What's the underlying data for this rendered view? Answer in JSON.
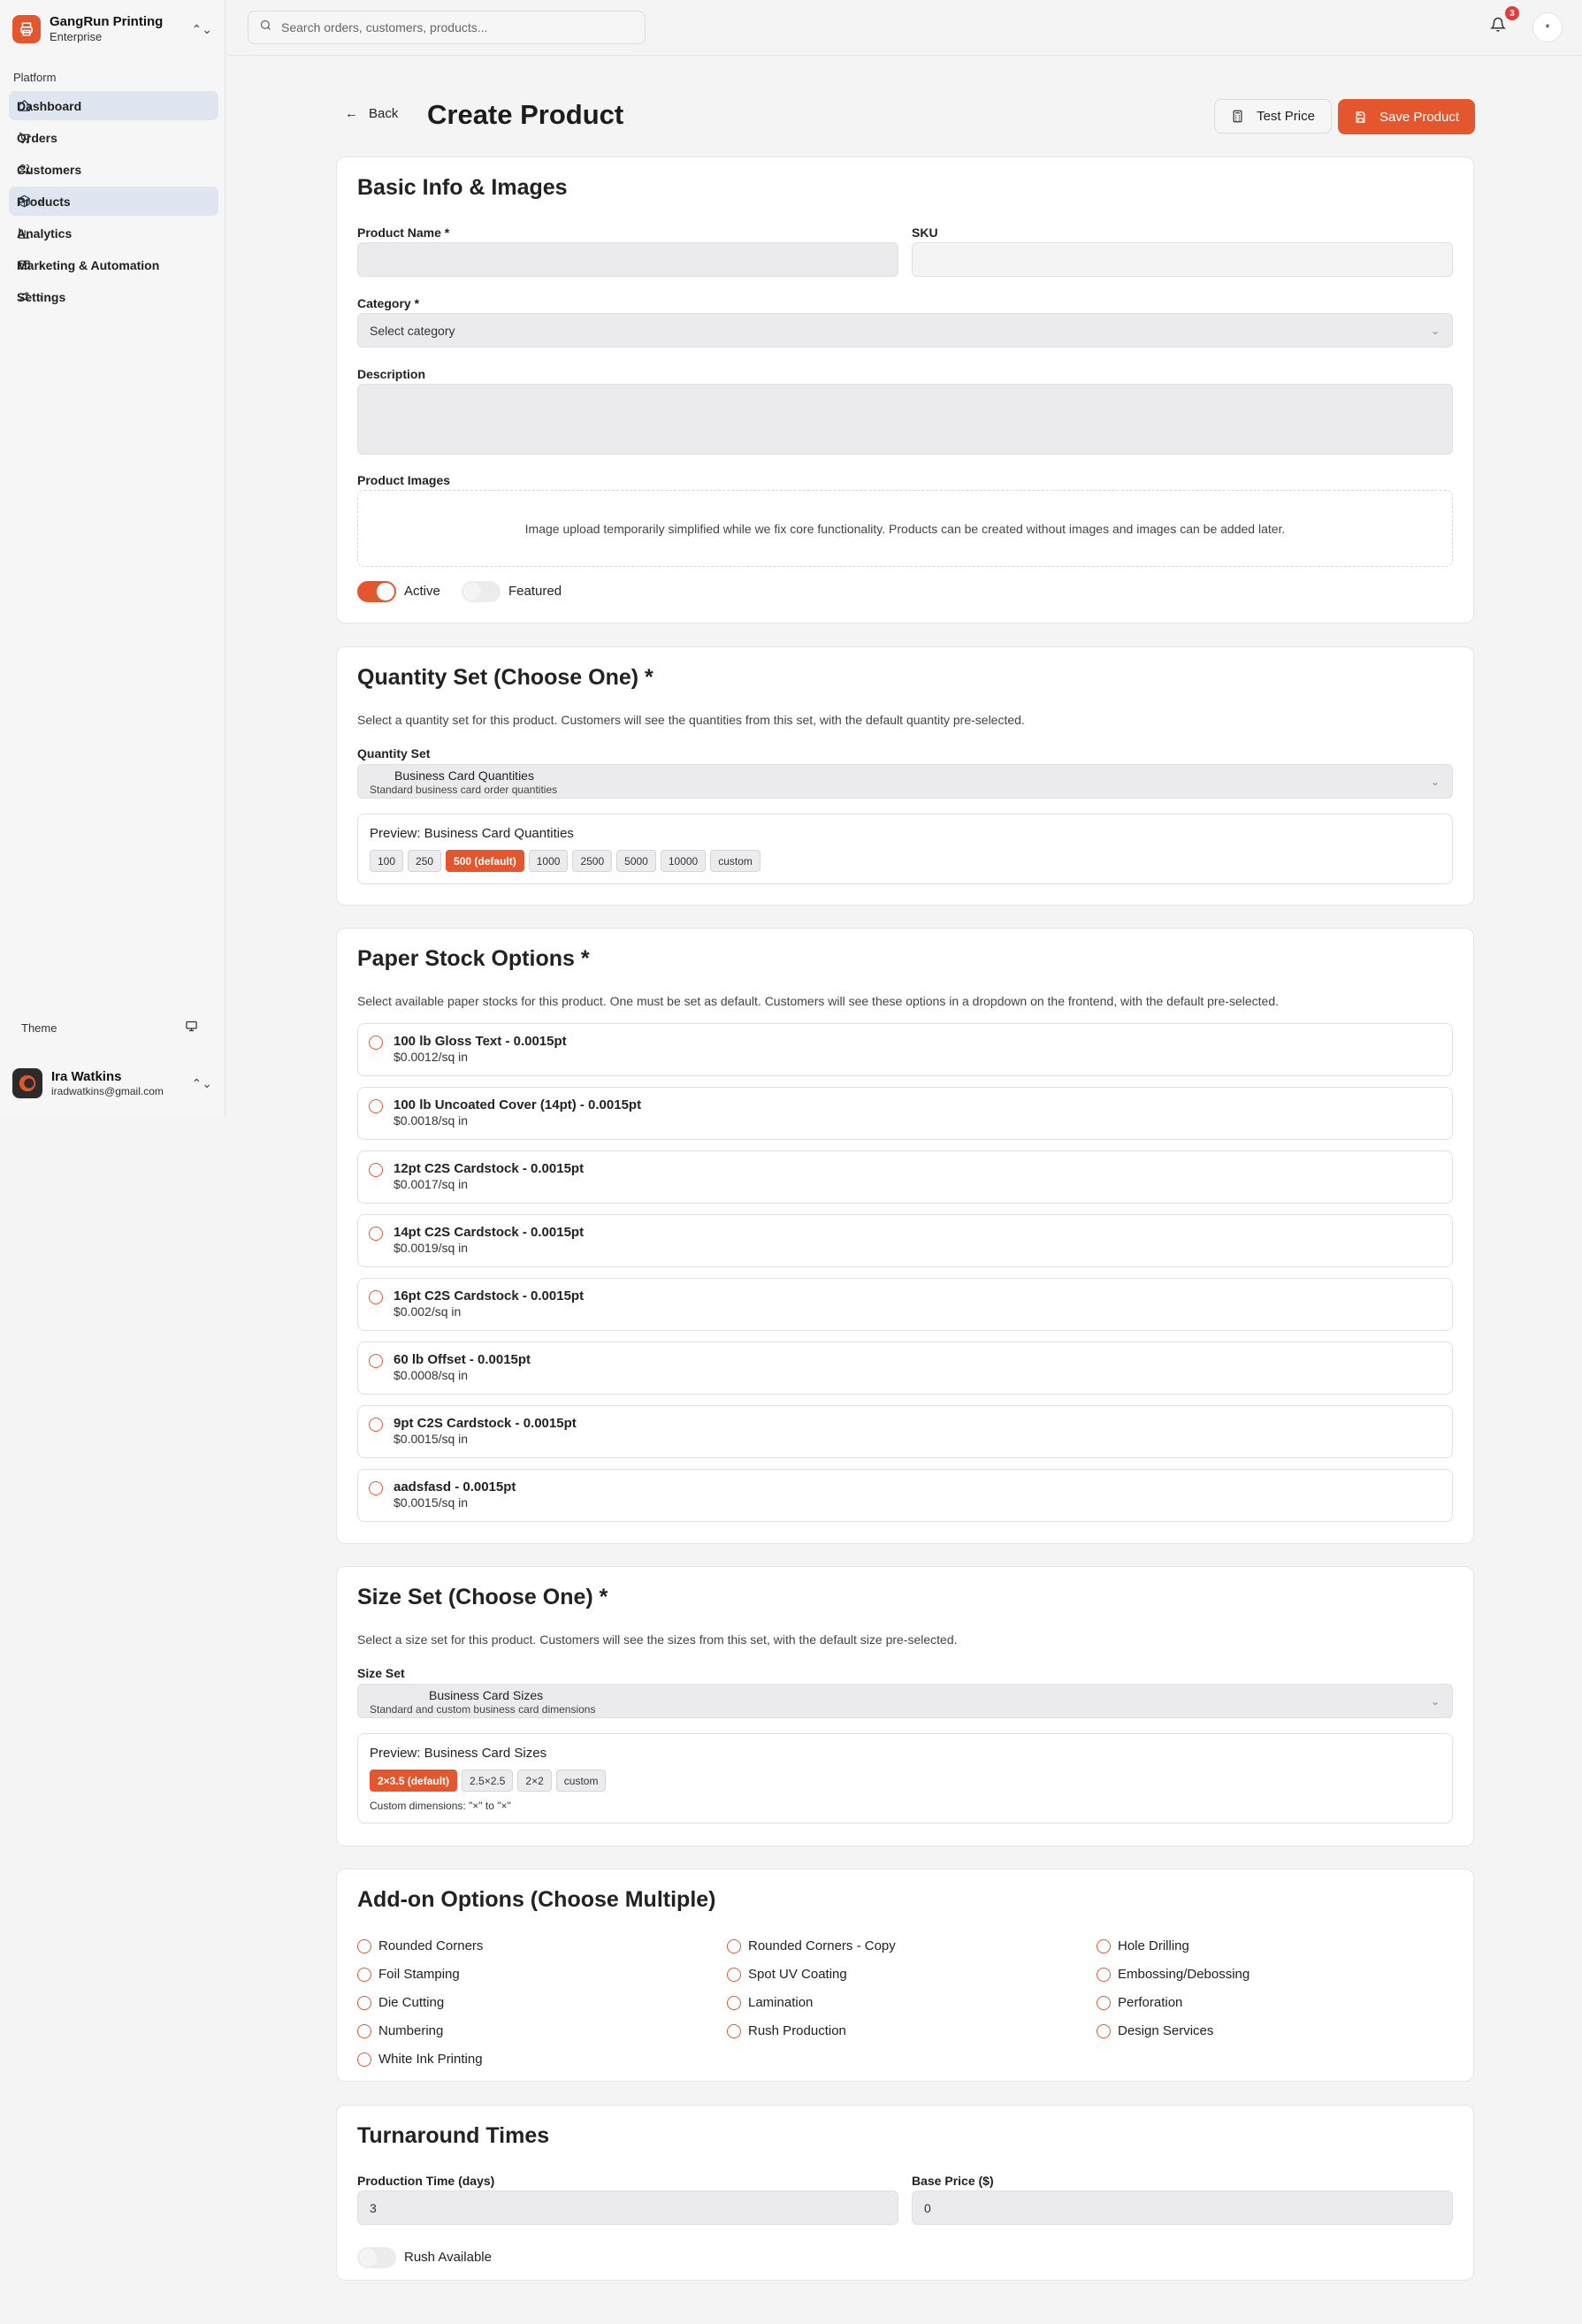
{
  "brand": {
    "name": "GangRun Printing",
    "plan": "Enterprise"
  },
  "sidebar": {
    "section_label": "Platform",
    "items": [
      {
        "label": "Dashboard"
      },
      {
        "label": "Orders"
      },
      {
        "label": "Customers"
      },
      {
        "label": "Products"
      },
      {
        "label": "Analytics"
      },
      {
        "label": "Marketing & Automation"
      },
      {
        "label": "Settings"
      }
    ],
    "theme_label": "Theme",
    "user": {
      "name": "Ira Watkins",
      "email": "iradwatkins@gmail.com"
    }
  },
  "topbar": {
    "search_placeholder": "Search orders, customers, products...",
    "notification_count": "3",
    "avatar_initial": "*"
  },
  "header": {
    "back_label": "Back",
    "title": "Create Product",
    "test_price_label": "Test Price",
    "save_label": "Save Product"
  },
  "basic_info": {
    "title": "Basic Info & Images",
    "product_name_label": "Product Name *",
    "sku_label": "SKU",
    "category_label": "Category *",
    "category_placeholder": "Select category",
    "description_label": "Description",
    "images_label": "Product Images",
    "images_note": "Image upload temporarily simplified while we fix core functionality. Products can be created without images and images can be added later.",
    "active_label": "Active",
    "featured_label": "Featured"
  },
  "quantity_set": {
    "title": "Quantity Set (Choose One) *",
    "help": "Select a quantity set for this product. Customers will see the quantities from this set, with the default quantity pre-selected.",
    "field_label": "Quantity Set",
    "selected_name": "Business Card Quantities",
    "selected_desc": "Standard business card order quantities",
    "preview_title": "Preview: Business Card Quantities",
    "chips": [
      "100",
      "250",
      "500 (default)",
      "1000",
      "2500",
      "5000",
      "10000",
      "custom"
    ]
  },
  "paper_stock": {
    "title": "Paper Stock Options *",
    "help": "Select available paper stocks for this product. One must be set as default. Customers will see these options in a dropdown on the frontend, with the default pre-selected.",
    "options": [
      {
        "name": "100 lb Gloss Text - 0.0015pt",
        "price": "$0.0012/sq in"
      },
      {
        "name": "100 lb Uncoated Cover (14pt) - 0.0015pt",
        "price": "$0.0018/sq in"
      },
      {
        "name": "12pt C2S Cardstock - 0.0015pt",
        "price": "$0.0017/sq in"
      },
      {
        "name": "14pt C2S Cardstock - 0.0015pt",
        "price": "$0.0019/sq in"
      },
      {
        "name": "16pt C2S Cardstock - 0.0015pt",
        "price": "$0.002/sq in"
      },
      {
        "name": "60 lb Offset - 0.0015pt",
        "price": "$0.0008/sq in"
      },
      {
        "name": "9pt C2S Cardstock - 0.0015pt",
        "price": "$0.0015/sq in"
      },
      {
        "name": "aadsfasd - 0.0015pt",
        "price": "$0.0015/sq in"
      }
    ]
  },
  "size_set": {
    "title": "Size Set (Choose One) *",
    "help": "Select a size set for this product. Customers will see the sizes from this set, with the default size pre-selected.",
    "field_label": "Size Set",
    "selected_name": "Business Card Sizes",
    "selected_desc": "Standard and custom business card dimensions",
    "preview_title": "Preview: Business Card Sizes",
    "chips": [
      "2×3.5 (default)",
      "2.5×2.5",
      "2×2",
      "custom"
    ],
    "custom_dimensions": "Custom dimensions: \"×\" to \"×\""
  },
  "addons": {
    "title": "Add-on Options (Choose Multiple)",
    "items": [
      "Rounded Corners",
      "Rounded Corners - Copy",
      "Hole Drilling",
      "Foil Stamping",
      "Spot UV Coating",
      "Embossing/Debossing",
      "Die Cutting",
      "Lamination",
      "Perforation",
      "Numbering",
      "Rush Production",
      "Design Services",
      "White Ink Printing"
    ]
  },
  "turnaround": {
    "title": "Turnaround Times",
    "production_label": "Production Time (days)",
    "production_value": "3",
    "base_price_label": "Base Price ($)",
    "base_price_value": "0",
    "rush_label": "Rush Available"
  },
  "colors": {
    "accent": "#e4572e",
    "nav_active_bg": "#dfe6ef",
    "badge": "#e23b3b"
  }
}
